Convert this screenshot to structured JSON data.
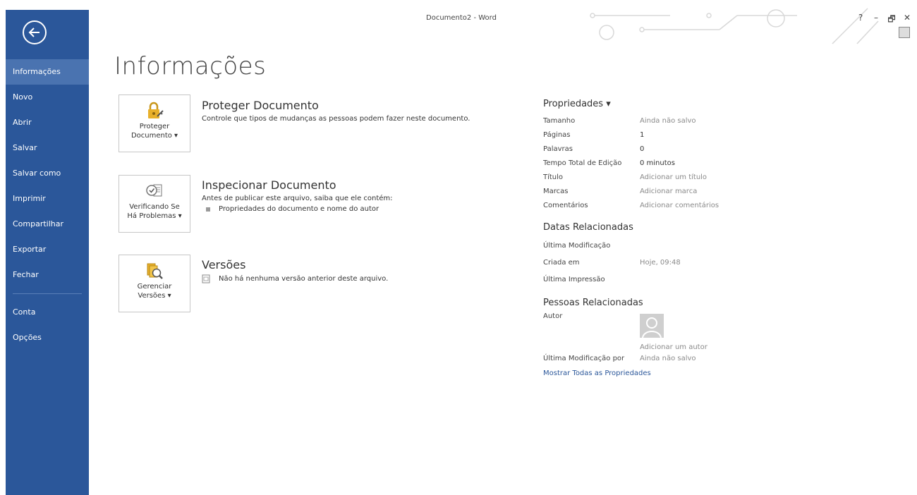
{
  "window": {
    "title": "Documento2 - Word",
    "controls": [
      "?",
      "–",
      "🗗",
      "✕"
    ]
  },
  "sidebar": {
    "items": [
      {
        "label": "Informações",
        "active": true
      },
      {
        "label": "Novo"
      },
      {
        "label": "Abrir"
      },
      {
        "label": "Salvar"
      },
      {
        "label": "Salvar como"
      },
      {
        "label": "Imprimir"
      },
      {
        "label": "Compartilhar"
      },
      {
        "label": "Exportar"
      },
      {
        "label": "Fechar"
      }
    ],
    "bottom_items": [
      {
        "label": "Conta"
      },
      {
        "label": "Opções"
      }
    ],
    "color": "#2b579a"
  },
  "main": {
    "title": "Informações",
    "sections": [
      {
        "button_line1": "Proteger",
        "button_line2": "Documento ▾",
        "heading": "Proteger Documento",
        "description": "Controle que tipos de mudanças as pessoas podem fazer neste documento."
      },
      {
        "button_line1": "Verificando Se",
        "button_line2": "Há Problemas ▾",
        "heading": "Inspecionar Documento",
        "description": "Antes de publicar este arquivo, saiba que ele contém:",
        "bullets": [
          "Propriedades do documento e nome do autor"
        ]
      },
      {
        "button_line1": "Gerenciar",
        "button_line2": "Versões ▾",
        "heading": "Versões",
        "description": "Não há nenhuma versão anterior deste arquivo."
      }
    ]
  },
  "properties": {
    "heading": "Propriedades ▾",
    "rows": [
      {
        "key": "Tamanho",
        "value": "Ainda não salvo"
      },
      {
        "key": "Páginas",
        "value": "1"
      },
      {
        "key": "Palavras",
        "value": "0"
      },
      {
        "key": "Tempo Total de Edição",
        "value": "0 minutos"
      },
      {
        "key": "Título",
        "value": "Adicionar um título"
      },
      {
        "key": "Marcas",
        "value": "Adicionar marca"
      },
      {
        "key": "Comentários",
        "value": "Adicionar comentários"
      }
    ],
    "dates_heading": "Datas Relacionadas",
    "dates": [
      {
        "key": "Última Modificação",
        "value": ""
      },
      {
        "key": "Criada em",
        "value": "Hoje, 09:48"
      },
      {
        "key": "Última Impressão",
        "value": ""
      }
    ],
    "people_heading": "Pessoas Relacionadas",
    "author_key": "Autor",
    "add_author": "Adicionar um autor",
    "last_modified_by_key": "Última Modificação por",
    "last_modified_by_value": "Ainda não salvo",
    "show_all": "Mostrar Todas as Propriedades"
  }
}
